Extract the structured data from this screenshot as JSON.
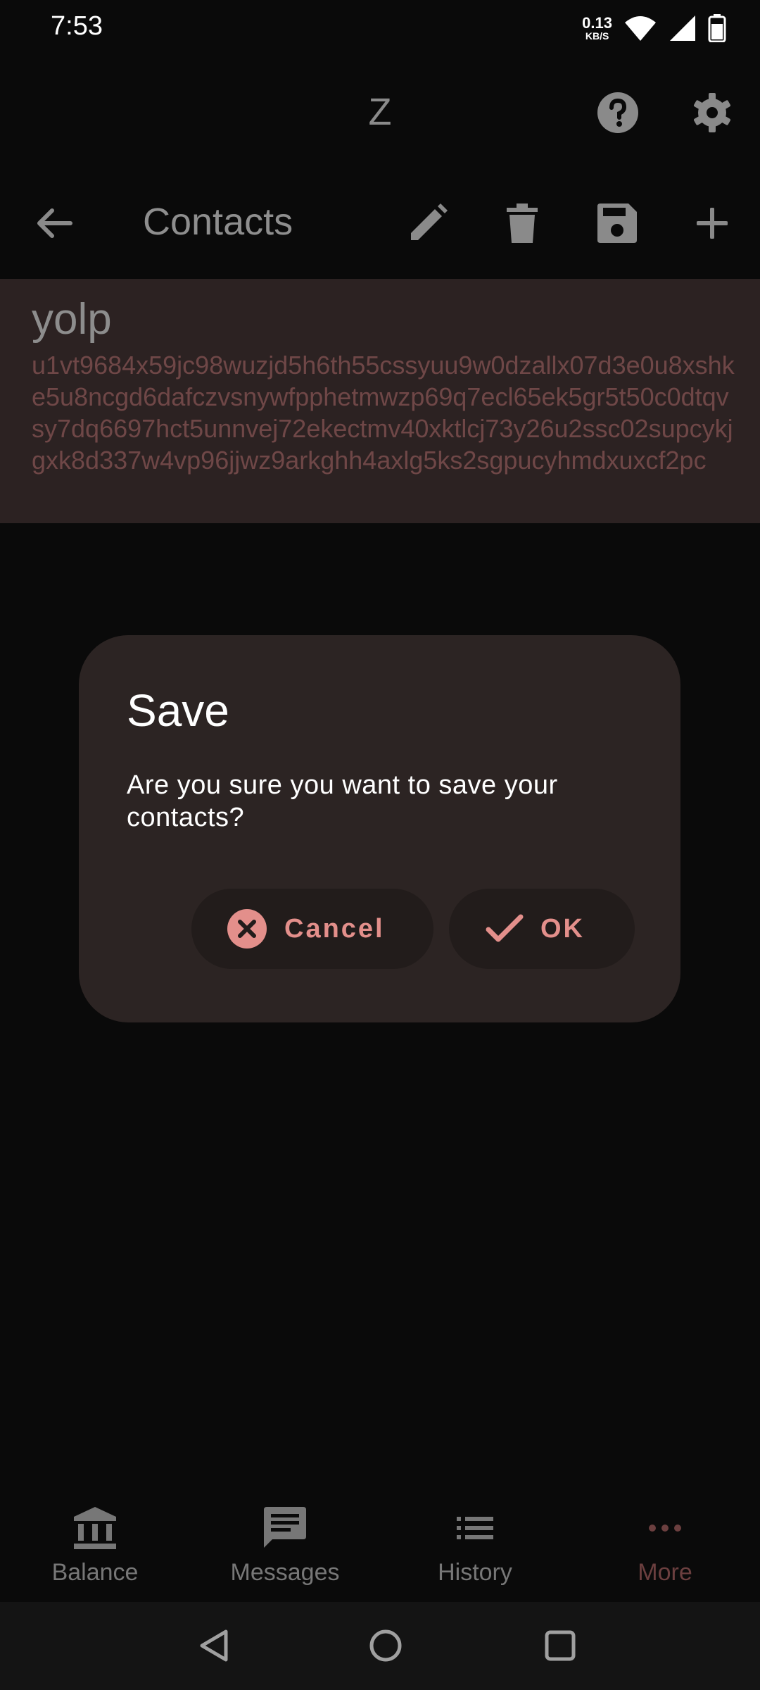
{
  "status_bar": {
    "time": "7:53",
    "net_speed_value": "0.13",
    "net_speed_unit": "KB/S"
  },
  "app_bar": {
    "title": "Z",
    "help_icon": "help-circle-icon",
    "settings_icon": "gear-icon"
  },
  "toolbar": {
    "back_icon": "arrow-back-icon",
    "title": "Contacts",
    "actions": [
      "edit-icon",
      "delete-icon",
      "save-icon",
      "add-icon"
    ]
  },
  "contact": {
    "name": "yolp",
    "address": "u1vt9684x59jc98wuzjd5h6th55cssyuu9w0dzallx07d3e0u8xshke5u8ncgd6dafczvsnywfpphetmwzp69q7ecl65ek5gr5t50c0dtqvsy7dq6697hct5unnvej72ekectmv40xktlcj73y26u2ssc02supcykjgxk8d337w4vp96jjwz9arkghh4axlg5ks2sgpucyhmdxuxcf2pc"
  },
  "dialog": {
    "title": "Save",
    "message": "Are you sure you want to save your contacts?",
    "cancel_label": "Cancel",
    "ok_label": "OK"
  },
  "bottom_nav": {
    "items": [
      {
        "label": "Balance",
        "icon": "bank-icon"
      },
      {
        "label": "Messages",
        "icon": "message-icon"
      },
      {
        "label": "History",
        "icon": "list-icon"
      },
      {
        "label": "More",
        "icon": "more-dots-icon",
        "active": true
      }
    ]
  },
  "colors": {
    "accent": "#e38f8b",
    "dialog_bg": "#2c2423",
    "contact_bg": "#2c2222"
  }
}
